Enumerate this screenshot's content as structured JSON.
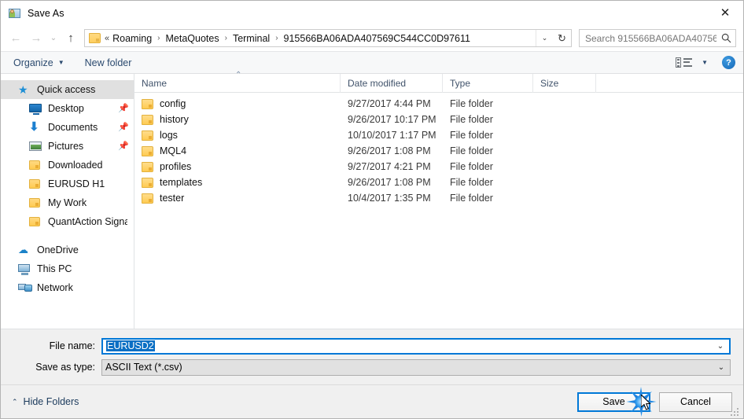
{
  "window": {
    "title": "Save As",
    "app_icon": "save-as-app-icon",
    "close_label": "✕"
  },
  "nav": {
    "back_icon": "←",
    "forward_icon": "→",
    "recent_icon": "⌄",
    "up_icon": "↑",
    "dropdown_icon": "⌄",
    "refresh_icon": "↻",
    "breadcrumb_lead": "«",
    "breadcrumb_sep": "›",
    "breadcrumbs": [
      "Roaming",
      "MetaQuotes",
      "Terminal",
      "915566BA06ADA407569C544CC0D97611"
    ]
  },
  "search": {
    "placeholder": "Search 915566BA06ADA40756...",
    "icon": "search-icon"
  },
  "toolbar": {
    "organize_label": "Organize",
    "organize_caret": "▼",
    "new_folder_label": "New folder",
    "view_caret": "▼",
    "help_label": "?"
  },
  "sidebar": {
    "items": [
      {
        "label": "Quick access",
        "icon": "star-pin-icon",
        "selected": true,
        "level": 1,
        "pin": ""
      },
      {
        "label": "Desktop",
        "icon": "desktop-icon",
        "selected": false,
        "level": 2,
        "pin": "📌"
      },
      {
        "label": "Documents",
        "icon": "documents-download-icon",
        "selected": false,
        "level": 2,
        "pin": "📌"
      },
      {
        "label": "Pictures",
        "icon": "pictures-icon",
        "selected": false,
        "level": 2,
        "pin": "📌"
      },
      {
        "label": "Downloaded",
        "icon": "folder-icon",
        "selected": false,
        "level": 2,
        "pin": ""
      },
      {
        "label": "EURUSD H1",
        "icon": "folder-icon",
        "selected": false,
        "level": 2,
        "pin": ""
      },
      {
        "label": "My Work",
        "icon": "folder-icon",
        "selected": false,
        "level": 2,
        "pin": ""
      },
      {
        "label": "QuantAction Signal",
        "icon": "folder-icon",
        "selected": false,
        "level": 2,
        "pin": ""
      }
    ],
    "items2": [
      {
        "label": "OneDrive",
        "icon": "onedrive-cloud-icon",
        "level": 1
      },
      {
        "label": "This PC",
        "icon": "this-pc-icon",
        "level": 1
      },
      {
        "label": "Network",
        "icon": "network-icon",
        "level": 1
      }
    ]
  },
  "filelist": {
    "columns": [
      "Name",
      "Date modified",
      "Type",
      "Size"
    ],
    "sort_caret": "⌃",
    "rows": [
      {
        "name": "config",
        "date": "9/27/2017 4:44 PM",
        "type": "File folder",
        "size": ""
      },
      {
        "name": "history",
        "date": "9/26/2017 10:17 PM",
        "type": "File folder",
        "size": ""
      },
      {
        "name": "logs",
        "date": "10/10/2017 1:17 PM",
        "type": "File folder",
        "size": ""
      },
      {
        "name": "MQL4",
        "date": "9/26/2017 1:08 PM",
        "type": "File folder",
        "size": ""
      },
      {
        "name": "profiles",
        "date": "9/27/2017 4:21 PM",
        "type": "File folder",
        "size": ""
      },
      {
        "name": "templates",
        "date": "9/26/2017 1:08 PM",
        "type": "File folder",
        "size": ""
      },
      {
        "name": "tester",
        "date": "10/4/2017 1:35 PM",
        "type": "File folder",
        "size": ""
      }
    ]
  },
  "form": {
    "filename_label": "File name:",
    "filename_value": "EURUSD2",
    "filetype_label": "Save as type:",
    "filetype_value": "ASCII Text (*.csv)",
    "dropdown_icon": "⌄"
  },
  "footer": {
    "hide_folders_label": "Hide Folders",
    "hide_folders_caret": "⌃",
    "save_label": "Save",
    "cancel_label": "Cancel"
  },
  "colors": {
    "accent": "#0078d7",
    "folder_yellow": "#ffcb52",
    "selection_blue": "#0b6fc4",
    "sidebar_selected": "#e0e0e0",
    "toolbar_bg": "#f7f8f9",
    "form_bg": "#f0f0f0"
  }
}
